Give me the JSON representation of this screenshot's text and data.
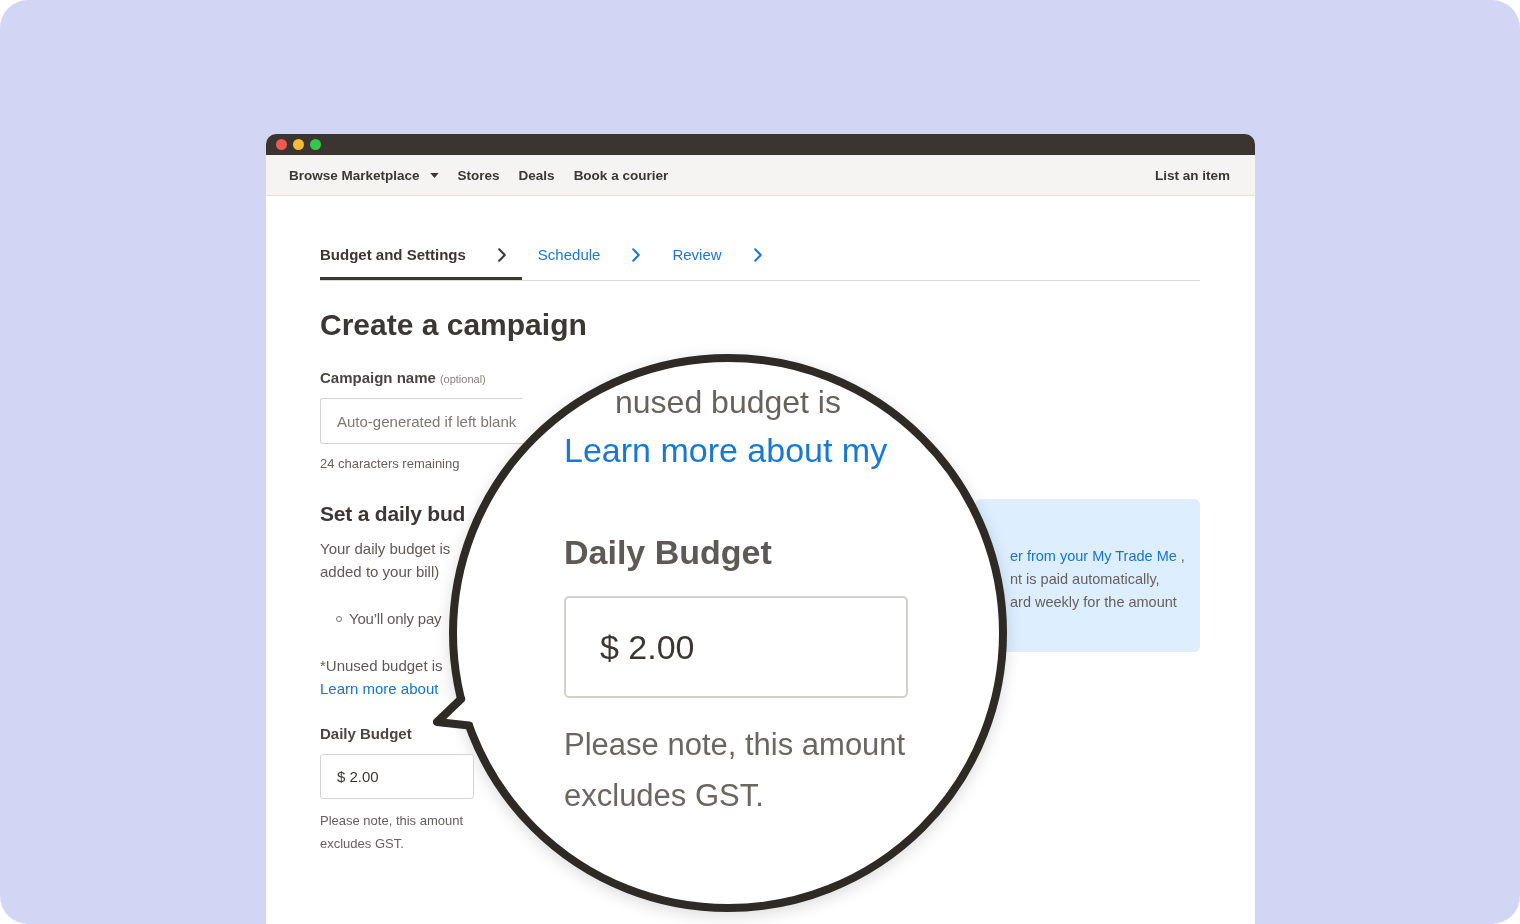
{
  "window_controls": [
    {
      "color": "#ee5a52"
    },
    {
      "color": "#f5bd2f"
    },
    {
      "color": "#34c749"
    }
  ],
  "nav": {
    "items": [
      {
        "label": "Browse Marketplace",
        "dropdown": true
      },
      {
        "label": "Stores",
        "dropdown": false
      },
      {
        "label": "Deals",
        "dropdown": false
      },
      {
        "label": "Book a courier",
        "dropdown": false
      }
    ],
    "action": "List an item"
  },
  "steps": [
    {
      "label": "Budget and Settings",
      "selected": true
    },
    {
      "label": "Schedule",
      "selected": false
    },
    {
      "label": "Review",
      "selected": false
    }
  ],
  "title": "Create a campaign",
  "campaign_name": {
    "label": "Campaign name",
    "optional_note": "(optional)",
    "placeholder": "Auto-generated if left blank",
    "hint": "24 characters remaining"
  },
  "daily_budget": {
    "heading": "Set a daily bud",
    "description_lines": [
      "Your daily budget is",
      "added to your bill)"
    ],
    "bullets": [
      "You’ll only pay"
    ],
    "note": "*Unused budget is",
    "link": "Learn more about",
    "field_label": "Daily Budget",
    "value": "$ 2.00",
    "hint": "Please note, this amount excludes GST."
  },
  "info_box": {
    "link": "er from your My Trade Me",
    "after_link": ",",
    "lines": [
      "nt is paid automatically,",
      "ard weekly for the amount"
    ]
  },
  "magnifier": {
    "note": "nused budget is",
    "link": "Learn more about my",
    "field_label": "Daily Budget",
    "value": "$ 2.00",
    "hint": "Please note, this amount excludes GST."
  }
}
